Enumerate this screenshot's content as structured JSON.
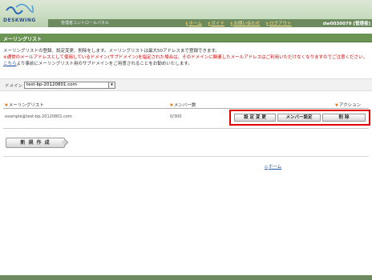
{
  "header": {
    "brand": "DESKWING",
    "control_panel": "管理者コントロールパネル",
    "nav": [
      {
        "label": "ホーム"
      },
      {
        "label": "ガイド"
      },
      {
        "label": "お問い合わせ"
      },
      {
        "label": "ログアウト"
      }
    ],
    "account": "dw0030079 [管理者]"
  },
  "section": {
    "title": "メーリングリスト"
  },
  "description": {
    "line1": "メーリングリストの登録、設定変更、削除をします。メーリングリストは最大50アドレスまで登録できます。",
    "line2": "※通常のメールアドレスとして使用しているドメイン(サブドメイン)を指定された場合は、そのドメインに関連したメールアドレスはご利用いただけなくなりますのでご注意ください。",
    "line3_link": "こちら",
    "line3_rest": "より事前にメーリングリスト用のサブドメインをご用意されることをお勧めいたします。"
  },
  "domain": {
    "label": "ドメイン",
    "value": "test-bp-20120801.com"
  },
  "table": {
    "columns": [
      "メーリングリスト",
      "メンバー数",
      "アクション"
    ],
    "rows": [
      {
        "address": "example@test-bp-20120801.com",
        "members": "0/300"
      }
    ],
    "actions": {
      "edit": "設 定 変 更",
      "members": "メンバー設定",
      "delete": "削 除"
    }
  },
  "buttons": {
    "new": "新 規 作 成"
  },
  "footer_link": {
    "label": "ホーム"
  },
  "colors": {
    "topbar": "#6c8a5e",
    "section": "#6c9454",
    "highlight": "#e00000",
    "link": "#2255aa",
    "warning": "#d20000"
  }
}
